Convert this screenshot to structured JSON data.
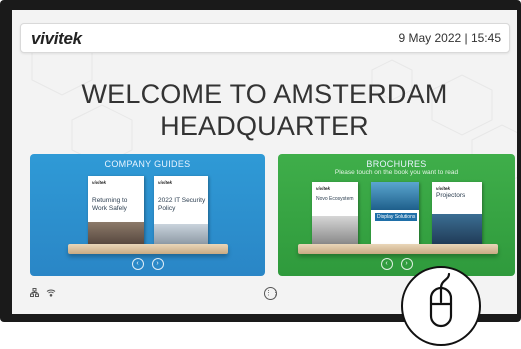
{
  "header": {
    "logo": "vivitek",
    "datetime": "9 May 2022 | 15:45"
  },
  "welcome": {
    "line1": "WELCOME TO AMSTERDAM",
    "line2": "HEADQUARTER"
  },
  "company_guides": {
    "title": "COMPANY GUIDES",
    "books": [
      {
        "logo": "vivitek",
        "title": "Returning to Work Safely"
      },
      {
        "logo": "vivitek",
        "title": "2022 IT Security Policy"
      }
    ]
  },
  "brochures": {
    "title": "BROCHURES",
    "subtitle": "Please touch on the book you want to read",
    "books": [
      {
        "logo": "vivitek",
        "title": "Novo Ecosystem"
      },
      {
        "logo": "",
        "title": "Display Solutions"
      },
      {
        "logo": "vivitek",
        "title": "Projectors"
      }
    ]
  },
  "colors": {
    "guides_bg": "#2a86c6",
    "brochures_bg": "#2f9a3c",
    "shelf": "#d8bf9b"
  }
}
